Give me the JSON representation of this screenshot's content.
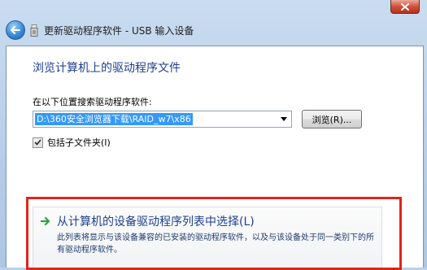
{
  "window": {
    "title": "更新驱动程序软件 - USB 输入设备"
  },
  "page": {
    "heading": "浏览计算机上的驱动程序文件",
    "search_label": "在以下位置搜索驱动程序软件:",
    "path_value": "D:\\360安全浏览器下载\\RAID_w7\\x86",
    "browse_label": "浏览(R)...",
    "include_subfolders_label": "包括子文件夹(I)",
    "include_subfolders_checked": true
  },
  "option": {
    "title": "从计算机的设备驱动程序列表中选择(L)",
    "description": "此列表将显示与该设备兼容的已安装的驱动程序软件，以及与该设备处于同一类别下的所有驱动程序软件。"
  },
  "icons": {
    "back": "back-arrow-icon",
    "device": "usb-device-icon",
    "close": "close-icon",
    "combo": "chevron-down-icon",
    "option": "green-arrow-icon",
    "checkbox": "checkmark-icon"
  },
  "colors": {
    "highlight": "#e0241c",
    "link": "#1f3f8f",
    "selection": "#3399ff",
    "arrow": "#2ea043"
  }
}
